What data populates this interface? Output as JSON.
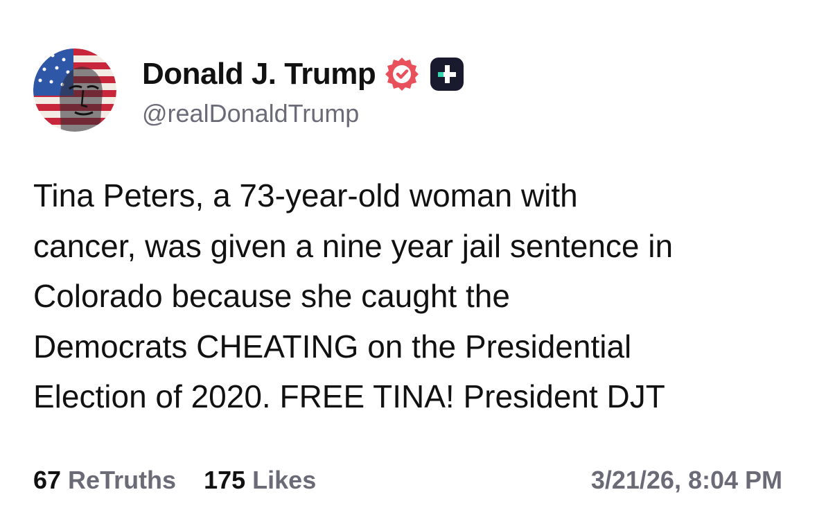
{
  "author": {
    "display_name": "Donald J. Trump",
    "handle": "@realDonaldTrump",
    "avatar": "flag-portrait-avatar",
    "verified_badge_icon": "verified-badge-icon",
    "subscriber_badge_icon": "plus-badge-icon"
  },
  "post": {
    "text_lines": [
      "Tina Peters, a 73-year-old woman with",
      "cancer, was given a nine year jail sentence in",
      "Colorado because she caught the",
      "Democrats CHEATING on the Presidential",
      "Election of 2020. FREE TINA! President DJT"
    ]
  },
  "stats": {
    "retruths_count": "67",
    "retruths_label": "ReTruths",
    "likes_count": "175",
    "likes_label": "Likes"
  },
  "timestamp": "3/21/26, 8:04 PM",
  "colors": {
    "text": "#111111",
    "muted": "#6b6b78",
    "verified": "#e8515b",
    "badge_bg": "#1a1a2e",
    "badge_accent": "#35d6b0"
  }
}
